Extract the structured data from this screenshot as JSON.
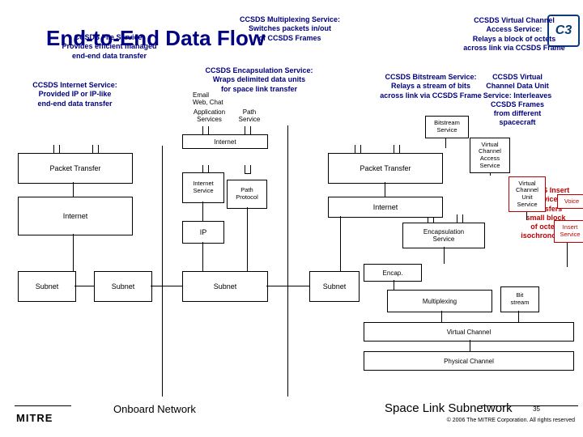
{
  "title": "End-to-End Data Flow",
  "callouts": {
    "file": "CCSDS File Service:\nProvides efficient managed\nend-end data transfer",
    "internet": "CCSDS Internet Service:\nProvided IP or IP-like\nend-end data transfer",
    "encap": "CCSDS Encapsulation Service:\nWraps delimited data units\nfor space link transfer",
    "mux": "CCSDS Multiplexing Service:\nSwitches packets in/out\nof CCSDS Frames",
    "bitstream": "CCSDS Bitstream Service:\nRelays a stream of bits\nacross link via CCSDS Frame",
    "vcaccess": "CCSDS Virtual Channel\nAccess Service:\nRelays a block of octets\nacross link via CCSDS Frame",
    "vcdu": "CCSDS Virtual\nChannel Data Unit\nService: Interleaves\nCCSDS Frames\nfrom different\nspacecraft",
    "insert": "CCSDS Insert\nService:\nTransfers\nsmall block\nof octets\nisochronously"
  },
  "apps": {
    "email": "Email\nWeb, Chat",
    "appsvc": "Application\nServices",
    "path": "Path\nService"
  },
  "boxes": {
    "pkt1": "Packet Transfer",
    "internet1": "Internet",
    "internetTop": "Internet",
    "internetSvc": "Internet\nService",
    "pathProto": "Path\nProtocol",
    "ip": "IP",
    "subnet": "Subnet",
    "pkt2": "Packet Transfer",
    "internet2": "Internet",
    "encapSvc": "Encapsulation\nService",
    "encap": "Encap.",
    "mux": "Multiplexing",
    "bit": "Bit\nstream",
    "bitSvc": "Bitstream\nService",
    "vcas": "Virtual\nChannel\nAccess\nService",
    "vcus": "Virtual\nChannel\nUnit\nService",
    "voice": "Voice",
    "insertSvc": "Insert\nService",
    "vc": "Virtual Channel",
    "phys": "Physical Channel"
  },
  "labels": {
    "onboard": "Onboard Network",
    "spacelink": "Space Link Subnetwork",
    "mitre": "MITRE",
    "c3": "C3",
    "copy": "© 2006 The MITRE Corporation. All rights reserved",
    "page": "35"
  }
}
